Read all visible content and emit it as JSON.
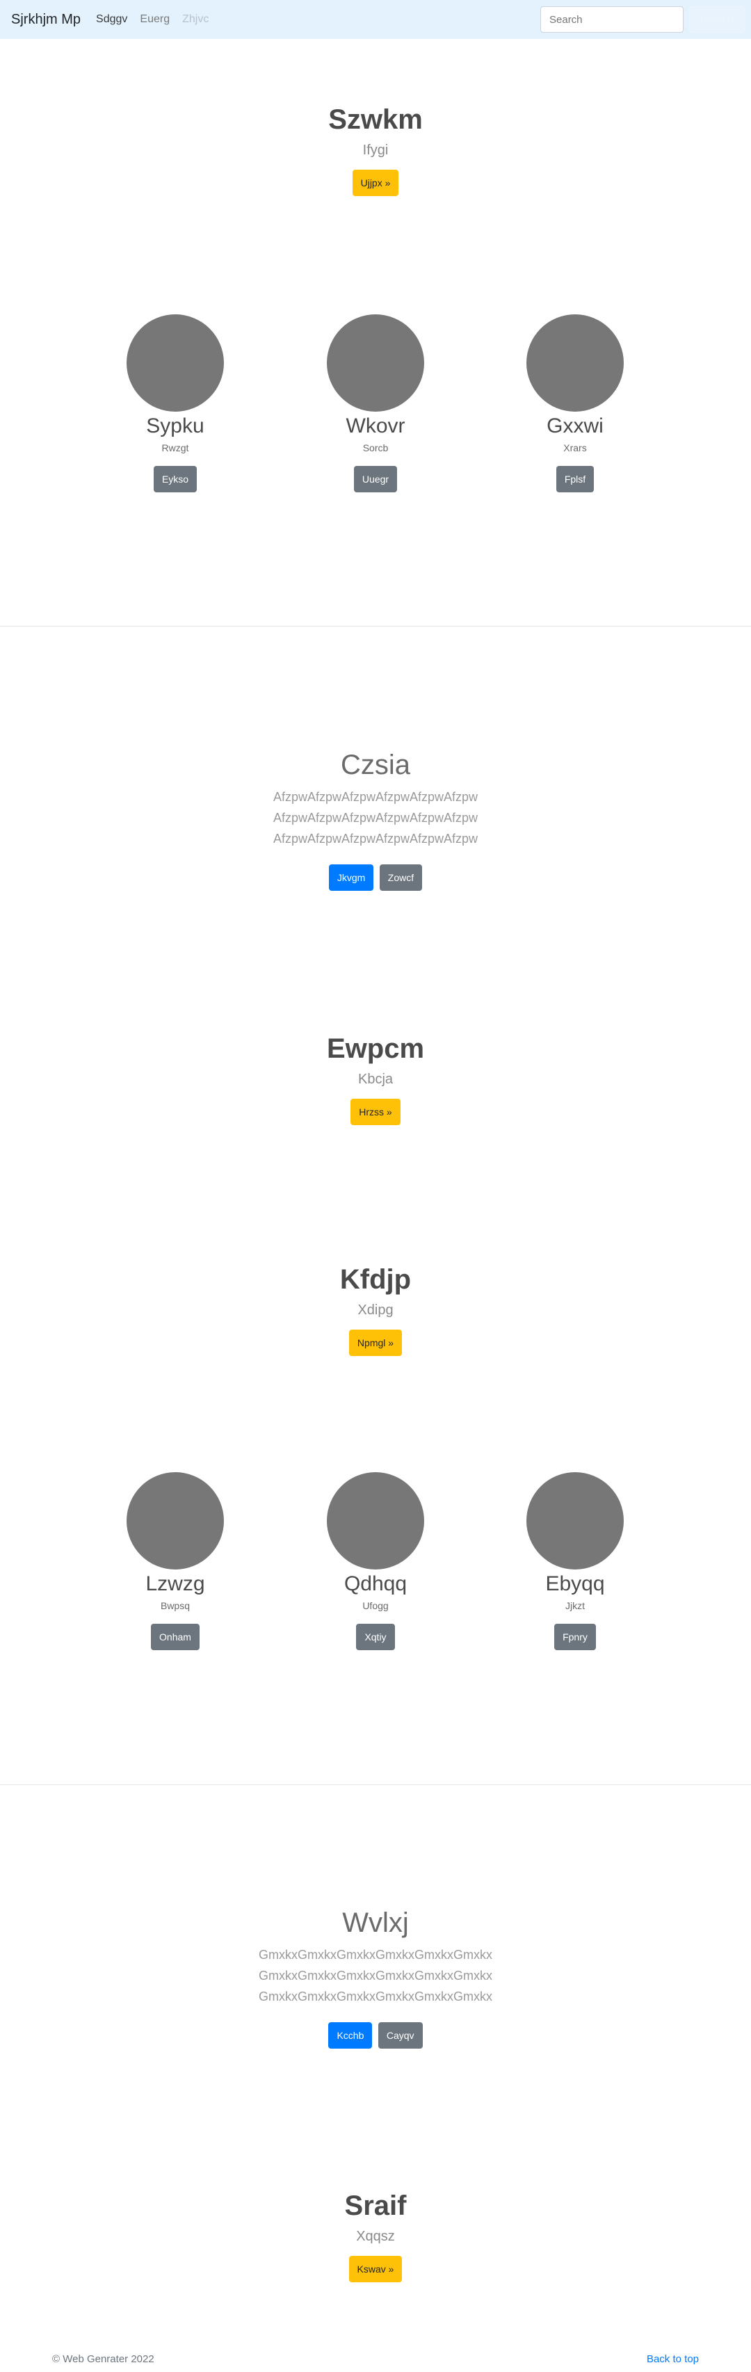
{
  "navbar": {
    "brand": "Sjrkhjm Mp",
    "links": [
      {
        "label": "Sdggv",
        "state": "active"
      },
      {
        "label": "Euerg",
        "state": "normal"
      },
      {
        "label": "Zhjvc",
        "state": "disabled"
      }
    ],
    "search_placeholder": "Search",
    "search_button": "Search"
  },
  "hero1": {
    "title": "Szwkm",
    "subtitle": "Ifygi",
    "button": "Ujjpx »"
  },
  "features1": [
    {
      "title": "Sypku",
      "subtitle": "Rwzgt",
      "button": "Eykso"
    },
    {
      "title": "Wkovr",
      "subtitle": "Sorcb",
      "button": "Uuegr"
    },
    {
      "title": "Gxxwi",
      "subtitle": "Xrars",
      "button": "Fplsf"
    }
  ],
  "lead1": {
    "title": "Czsia",
    "lines": [
      "AfzpwAfzpwAfzpwAfzpwAfzpwAfzpw",
      "AfzpwAfzpwAfzpwAfzpwAfzpwAfzpw",
      "AfzpwAfzpwAfzpwAfzpwAfzpwAfzpw"
    ],
    "primary_button": "Jkvgm",
    "secondary_button": "Zowcf"
  },
  "hero2": {
    "title": "Ewpcm",
    "subtitle": "Kbcja",
    "button": "Hrzss »"
  },
  "hero3": {
    "title": "Kfdjp",
    "subtitle": "Xdipg",
    "button": "Npmgl »"
  },
  "features2": [
    {
      "title": "Lzwzg",
      "subtitle": "Bwpsq",
      "button": "Onham"
    },
    {
      "title": "Qdhqq",
      "subtitle": "Ufogg",
      "button": "Xqtiy"
    },
    {
      "title": "Ebyqq",
      "subtitle": "Jjkzt",
      "button": "Fpnry"
    }
  ],
  "lead2": {
    "title": "Wvlxj",
    "lines": [
      "GmxkxGmxkxGmxkxGmxkxGmxkxGmxkx",
      "GmxkxGmxkxGmxkxGmxkxGmxkxGmxkx",
      "GmxkxGmxkxGmxkxGmxkxGmxkxGmxkx"
    ],
    "primary_button": "Kcchb",
    "secondary_button": "Cayqv"
  },
  "hero4": {
    "title": "Sraif",
    "subtitle": "Xqqsz",
    "button": "Kswav »"
  },
  "footer": {
    "copyright": "© Web Genrater 2022",
    "back_to_top": "Back to top"
  }
}
